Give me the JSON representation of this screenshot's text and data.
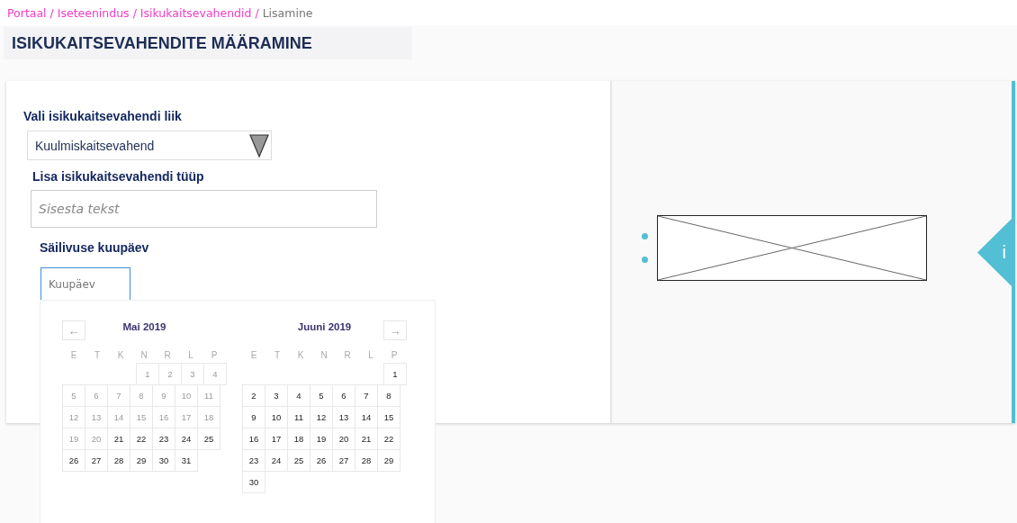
{
  "breadcrumb": [
    {
      "label": "Portaal /",
      "kind": "link"
    },
    {
      "label": "Iseteenindus",
      "kind": "link"
    },
    {
      "label": "/ Isikukaitsevahendid /",
      "kind": "link"
    },
    {
      "label": "Lisamine",
      "kind": "current"
    }
  ],
  "page_title": "ISIKUKAITSEVAHENDITE MÄÄRAMINE",
  "form": {
    "type_label": "Vali isikukaitsevahendi liik",
    "type_select": {
      "value": "Kuulmiskaitsevahend"
    },
    "model_label": "Lisa isikukaitsevahendi tüüp",
    "model_input": {
      "placeholder": "Sisesta tekst"
    },
    "date_label": "Säilivuse kuupäev",
    "date_input": {
      "placeholder": "Kuupäev"
    }
  },
  "datepicker": {
    "prev": "←",
    "next": "→",
    "months": [
      {
        "title": "Mai 2019",
        "weekdays": [
          "E",
          "T",
          "K",
          "N",
          "R",
          "L",
          "P"
        ],
        "weeks": [
          [
            {
              "label": "1",
              "disabled": true
            },
            {
              "label": "2",
              "disabled": true
            },
            {
              "label": "3",
              "disabled": true
            },
            {
              "label": "4",
              "disabled": true
            }
          ],
          [
            {
              "label": "5",
              "disabled": true
            },
            {
              "label": "6",
              "disabled": true
            },
            {
              "label": "7",
              "disabled": true
            },
            {
              "label": "8",
              "disabled": true
            },
            {
              "label": "9",
              "disabled": true
            },
            {
              "label": "10",
              "disabled": true
            },
            {
              "label": "11",
              "disabled": true
            }
          ],
          [
            {
              "label": "12",
              "disabled": true
            },
            {
              "label": "13",
              "disabled": true
            },
            {
              "label": "14",
              "disabled": true
            },
            {
              "label": "15",
              "disabled": true
            },
            {
              "label": "16",
              "disabled": true
            },
            {
              "label": "17",
              "disabled": true
            },
            {
              "label": "18",
              "disabled": true
            }
          ],
          [
            {
              "label": "19",
              "disabled": true
            },
            {
              "label": "20",
              "disabled": true
            },
            {
              "label": "21",
              "disabled": false
            },
            {
              "label": "22",
              "disabled": false
            },
            {
              "label": "23",
              "disabled": false
            },
            {
              "label": "24",
              "disabled": false
            },
            {
              "label": "25",
              "disabled": false
            }
          ],
          [
            {
              "label": "26",
              "disabled": false
            },
            {
              "label": "27",
              "disabled": false
            },
            {
              "label": "28",
              "disabled": false
            },
            {
              "label": "29",
              "disabled": false
            },
            {
              "label": "30",
              "disabled": false
            },
            {
              "label": "31",
              "disabled": false
            }
          ]
        ]
      },
      {
        "title": "Juuni 2019",
        "weekdays": [
          "E",
          "T",
          "K",
          "N",
          "R",
          "L",
          "P"
        ],
        "weeks": [
          [
            {
              "label": "1",
              "disabled": false
            }
          ],
          [
            {
              "label": "2",
              "disabled": false
            },
            {
              "label": "3",
              "disabled": false
            },
            {
              "label": "4",
              "disabled": false
            },
            {
              "label": "5",
              "disabled": false
            },
            {
              "label": "6",
              "disabled": false
            },
            {
              "label": "7",
              "disabled": false
            },
            {
              "label": "8",
              "disabled": false
            }
          ],
          [
            {
              "label": "9",
              "disabled": false
            },
            {
              "label": "10",
              "disabled": false
            },
            {
              "label": "11",
              "disabled": false
            },
            {
              "label": "12",
              "disabled": false
            },
            {
              "label": "13",
              "disabled": false
            },
            {
              "label": "14",
              "disabled": false
            },
            {
              "label": "15",
              "disabled": false
            }
          ],
          [
            {
              "label": "16",
              "disabled": false
            },
            {
              "label": "17",
              "disabled": false
            },
            {
              "label": "18",
              "disabled": false
            },
            {
              "label": "19",
              "disabled": false
            },
            {
              "label": "20",
              "disabled": false
            },
            {
              "label": "21",
              "disabled": false
            },
            {
              "label": "22",
              "disabled": false
            }
          ],
          [
            {
              "label": "23",
              "disabled": false
            },
            {
              "label": "24",
              "disabled": false
            },
            {
              "label": "25",
              "disabled": false
            },
            {
              "label": "26",
              "disabled": false
            },
            {
              "label": "27",
              "disabled": false
            },
            {
              "label": "28",
              "disabled": false
            },
            {
              "label": "29",
              "disabled": false
            }
          ],
          [
            {
              "label": "30",
              "disabled": false
            }
          ]
        ]
      }
    ]
  },
  "info_tab": {
    "label": "i"
  }
}
